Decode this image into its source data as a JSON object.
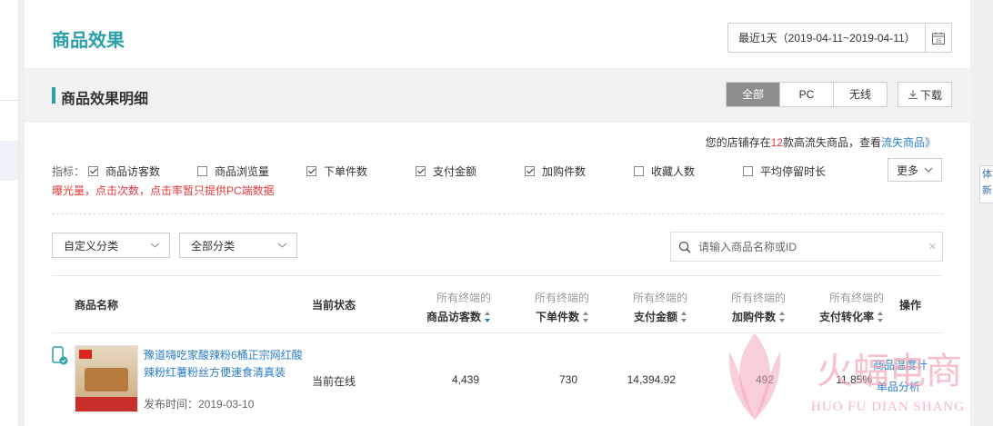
{
  "header": {
    "title": "商品效果",
    "date_range": "最近1天（2019-04-11~2019-04-11）"
  },
  "section": {
    "title": "商品效果明细",
    "segments": [
      "全部",
      "PC",
      "无线"
    ],
    "active_segment": "全部",
    "download_label": "下载"
  },
  "notice": {
    "prefix": "您的店铺存在",
    "count": "12",
    "middle": "款高流失商品，查看",
    "link": "流失商品》"
  },
  "indicators": {
    "label": "指标：",
    "items": [
      {
        "label": "商品访客数",
        "checked": true
      },
      {
        "label": "商品浏览量",
        "checked": false
      },
      {
        "label": "下单件数",
        "checked": true
      },
      {
        "label": "支付金额",
        "checked": true
      },
      {
        "label": "加购件数",
        "checked": true
      },
      {
        "label": "收藏人数",
        "checked": false
      },
      {
        "label": "平均停留时长",
        "checked": false
      }
    ],
    "more_label": "更多",
    "warning": "曝光量，点击次数，点击率暂只提供PC端数据"
  },
  "filters": {
    "category1": "自定义分类",
    "category2": "全部分类",
    "search_placeholder": "请输入商品名称或ID"
  },
  "table": {
    "col_name": "商品名称",
    "col_status": "当前状态",
    "col_prefix": "所有终端的",
    "col_visitors": "商品访客数",
    "col_orders": "下单件数",
    "col_amount": "支付金额",
    "col_cart": "加购件数",
    "col_conversion": "支付转化率",
    "col_action": "操作",
    "rows": [
      {
        "name": "豫道嗨吃家酸辣粉6桶正宗网红酸辣粉红薯粉丝方便速食清真装",
        "publish_time": "发布时间：2019-03-10",
        "status": "当前在线",
        "visitors": "4,439",
        "orders": "730",
        "amount": "14,394.92",
        "cart": "492",
        "conversion": "11.85%",
        "action1": "商品温度计",
        "action2": "单品分析"
      }
    ]
  },
  "side_tab_text": "体新",
  "watermark": {
    "cn": "火蝠电商",
    "en": "HUO FU DIAN SHANG"
  },
  "colors": {
    "brand_teal": "#2ba0aa",
    "link_blue": "#2b7dc8",
    "alert_red": "#e4393c"
  }
}
